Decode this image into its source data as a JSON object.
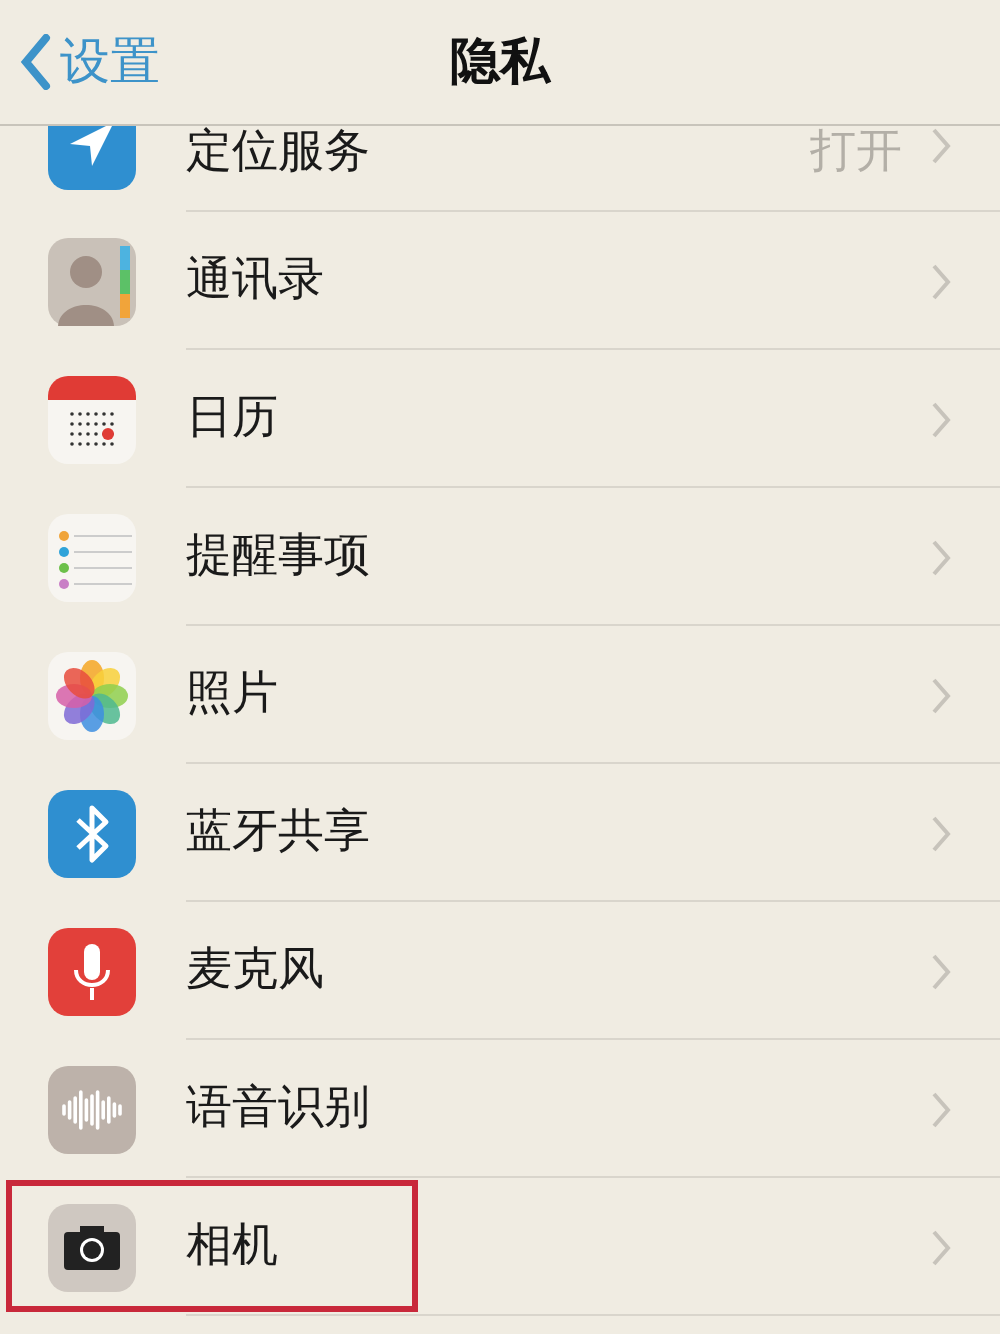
{
  "nav_bar": {
    "back": "设置",
    "title": "隐私"
  },
  "items": [
    {
      "kind": "location",
      "label": "定位服务",
      "value": "打开",
      "highlighted": false
    },
    {
      "kind": "contacts",
      "label": "通讯录",
      "highlighted": false
    },
    {
      "kind": "calendar",
      "label": "日历",
      "highlighted": false
    },
    {
      "kind": "reminders",
      "label": "提醒事项",
      "highlighted": false
    },
    {
      "kind": "photos",
      "label": "照片",
      "highlighted": false
    },
    {
      "kind": "bluetooth",
      "label": "蓝牙共享",
      "highlighted": false
    },
    {
      "kind": "microphone",
      "label": "麦克风",
      "highlighted": false
    },
    {
      "kind": "speech",
      "label": "语音识别",
      "highlighted": false
    },
    {
      "kind": "camera",
      "label": "相机",
      "highlighted": true
    }
  ]
}
